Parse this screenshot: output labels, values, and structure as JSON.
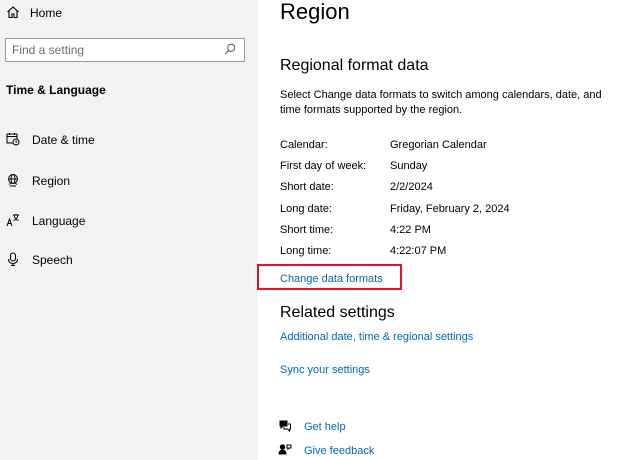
{
  "sidebar": {
    "home": {
      "label": "Home",
      "icon": "home-icon"
    },
    "search": {
      "placeholder": "Find a setting",
      "icon": "search-icon"
    },
    "section_title": "Time & Language",
    "items": [
      {
        "label": "Date & time",
        "icon": "calendar-clock-icon"
      },
      {
        "label": "Region",
        "icon": "globe-icon"
      },
      {
        "label": "Language",
        "icon": "language-icon"
      },
      {
        "label": "Speech",
        "icon": "microphone-icon"
      }
    ]
  },
  "main": {
    "title": "Region",
    "regional_format": {
      "heading": "Regional format data",
      "description": "Select Change data formats to switch among calendars, date, and time formats supported by the region.",
      "rows": [
        {
          "label": "Calendar:",
          "value": "Gregorian Calendar"
        },
        {
          "label": "First day of week:",
          "value": "Sunday"
        },
        {
          "label": "Short date:",
          "value": "2/2/2024"
        },
        {
          "label": "Long date:",
          "value": "Friday, February 2, 2024"
        },
        {
          "label": "Short time:",
          "value": "4:22 PM"
        },
        {
          "label": "Long time:",
          "value": "4:22:07 PM"
        }
      ],
      "change_link": "Change data formats"
    },
    "related": {
      "heading": "Related settings",
      "links": [
        "Additional date, time & regional settings",
        "Sync your settings"
      ]
    },
    "help": [
      {
        "label": "Get help",
        "icon": "help-chat-icon"
      },
      {
        "label": "Give feedback",
        "icon": "feedback-icon"
      }
    ]
  },
  "colors": {
    "link": "#0067b8",
    "highlight": "#e81123",
    "sidebar_bg": "#f2f2f2"
  }
}
